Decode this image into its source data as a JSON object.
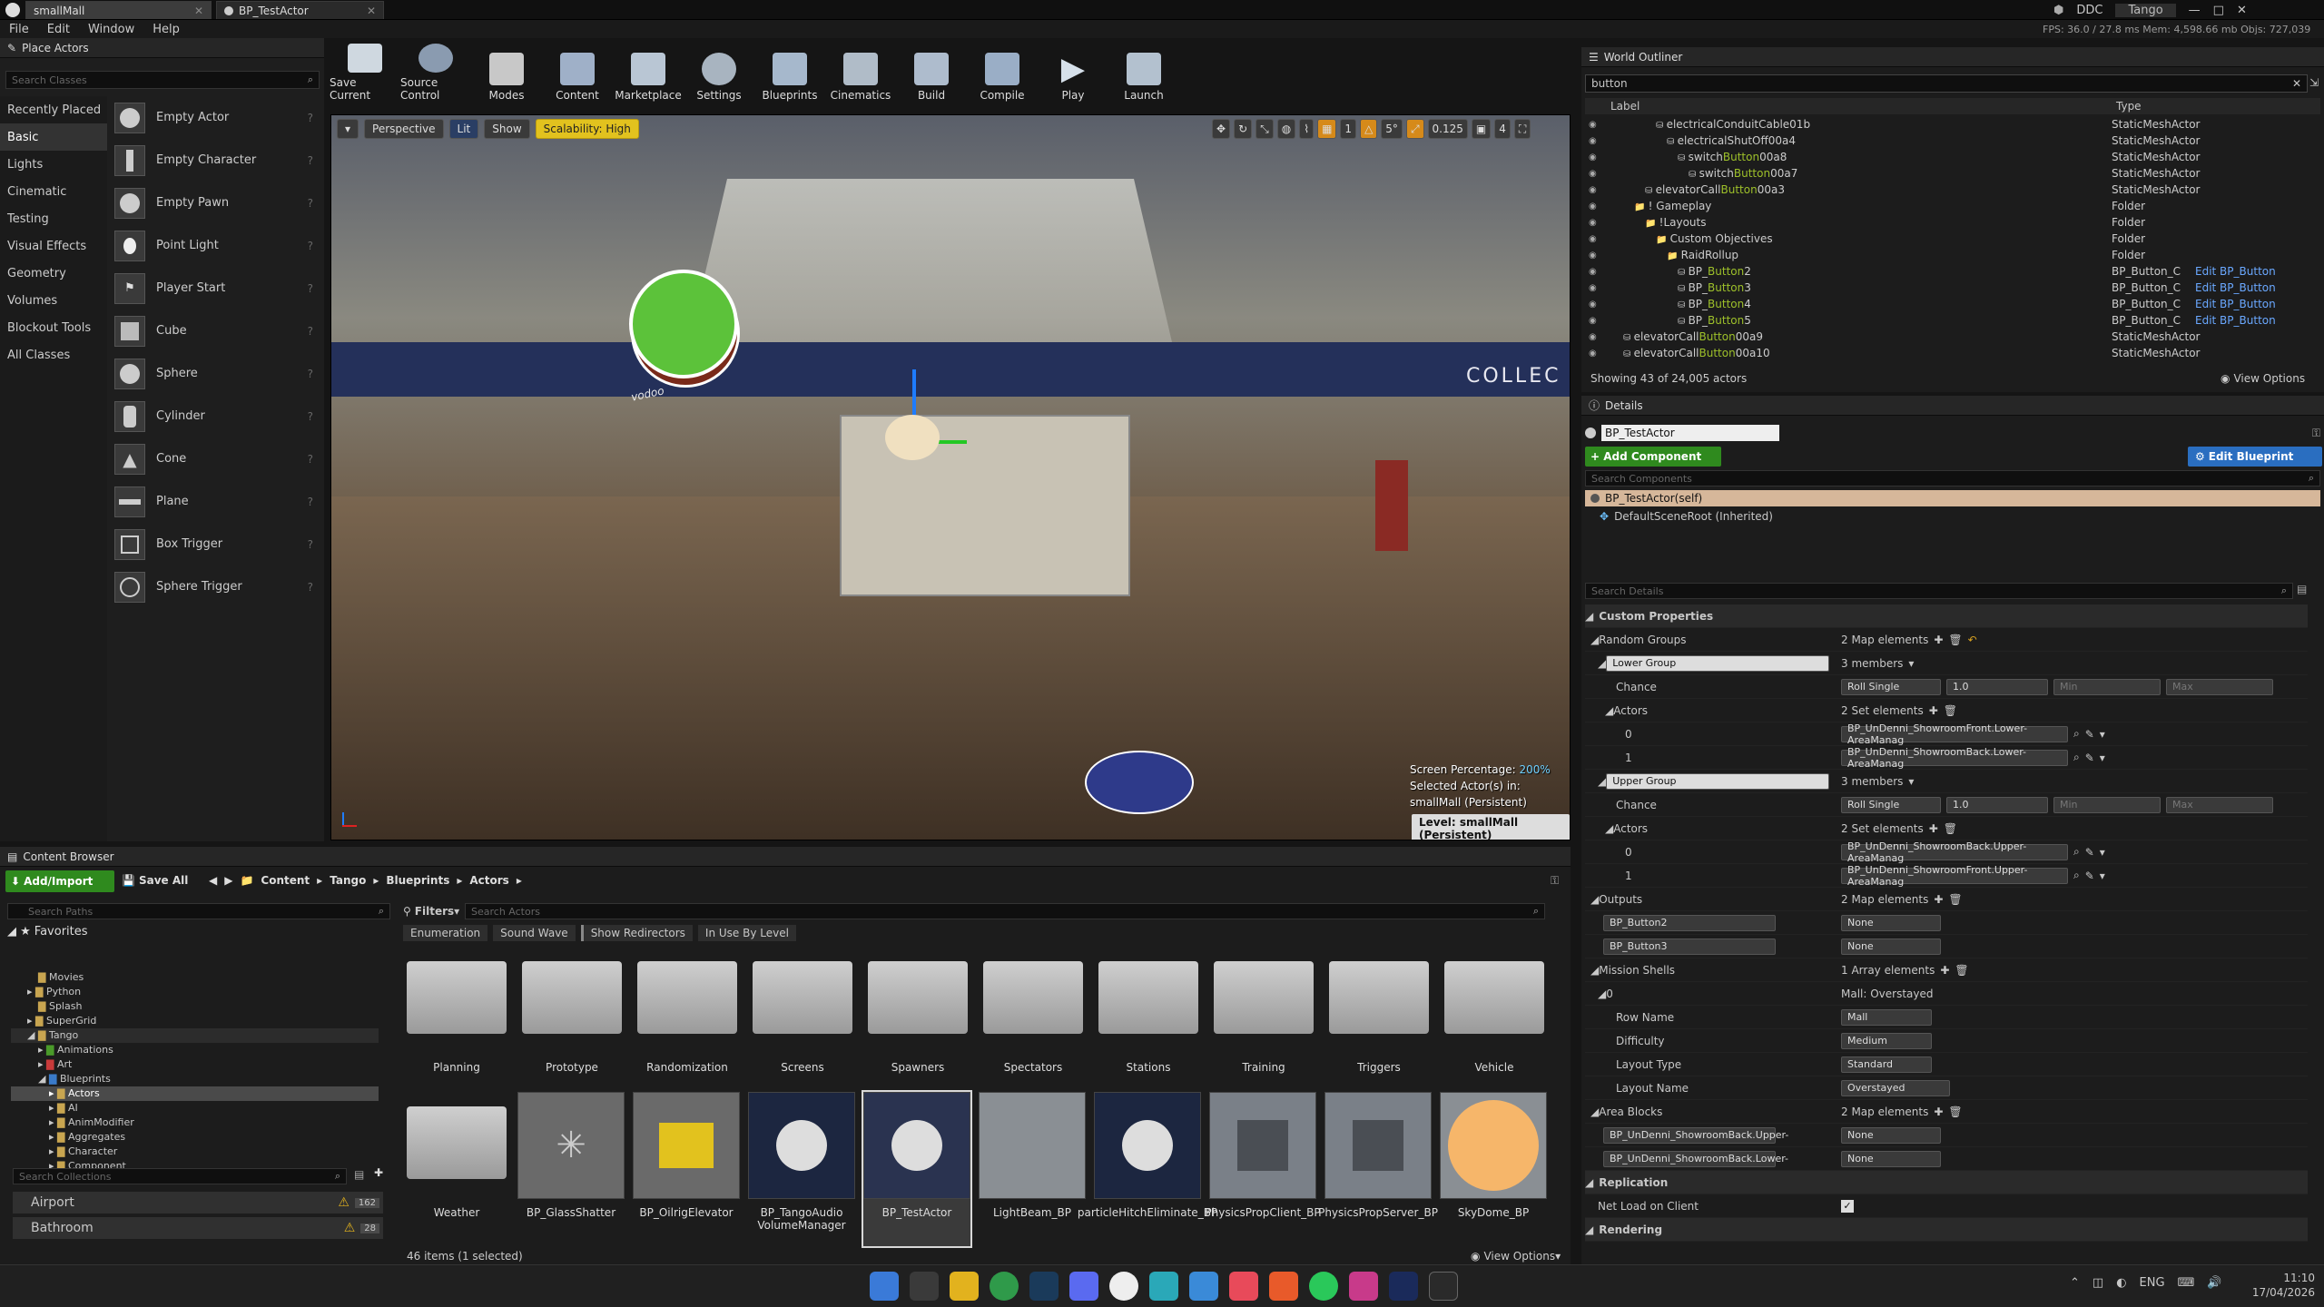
{
  "window": {
    "tab1": "smallMall",
    "tab2": "BP_TestActor",
    "ddc": "DDC",
    "project": "Tango",
    "stats": "FPS: 36.0  /  27.8 ms  Mem: 4,598.66 mb  Objs: 727,039"
  },
  "menu": [
    "File",
    "Edit",
    "Window",
    "Help"
  ],
  "place": {
    "title": "Place Actors",
    "search_placeholder": "Search Classes",
    "categories": [
      "Recently Placed",
      "Basic",
      "Lights",
      "Cinematic",
      "Testing",
      "Visual Effects",
      "Geometry",
      "Volumes",
      "Blockout Tools",
      "All Classes"
    ],
    "items": [
      "Empty Actor",
      "Empty Character",
      "Empty Pawn",
      "Point Light",
      "Player Start",
      "Cube",
      "Sphere",
      "Cylinder",
      "Cone",
      "Plane",
      "Box Trigger",
      "Sphere Trigger"
    ]
  },
  "toolbar": [
    "Save Current",
    "Source Control",
    "Modes",
    "Content",
    "Marketplace",
    "Settings",
    "Blueprints",
    "Cinematics",
    "Build",
    "Compile",
    "Play",
    "Launch"
  ],
  "viewport": {
    "perspective": "Perspective",
    "lit": "Lit",
    "show": "Show",
    "scalability": "Scalability: High",
    "snap_angle": "5°",
    "snap_scale": "0.125",
    "cam_speed": "4",
    "screen_pct_label": "Screen Percentage:",
    "screen_pct": "200%",
    "selected": "Selected Actor(s) in:",
    "level_name": "smallMall (Persistent)",
    "level_badge": "Level:  smallMall (Persistent)",
    "sign": "COLLEC",
    "decal": "vodoo"
  },
  "outliner": {
    "title": "World Outliner",
    "search": "button",
    "col_label": "Label",
    "col_type": "Type",
    "rows": [
      {
        "pre": "electricalConduitCable01b",
        "hl": "",
        "post": "",
        "type": "StaticMeshActor",
        "link": "",
        "indent": 4
      },
      {
        "pre": "electricalShutOff00a4",
        "hl": "",
        "post": "",
        "type": "StaticMeshActor",
        "link": "",
        "indent": 5
      },
      {
        "pre": "switch",
        "hl": "Button",
        "post": "00a8",
        "type": "StaticMeshActor",
        "link": "",
        "indent": 6
      },
      {
        "pre": "switch",
        "hl": "Button",
        "post": "00a7",
        "type": "StaticMeshActor",
        "link": "",
        "indent": 7
      },
      {
        "pre": "elevatorCall",
        "hl": "Button",
        "post": "00a3",
        "type": "StaticMeshActor",
        "link": "",
        "indent": 3
      },
      {
        "pre": "! Gameplay",
        "hl": "",
        "post": "",
        "type": "Folder",
        "link": "",
        "indent": 2
      },
      {
        "pre": "!Layouts",
        "hl": "",
        "post": "",
        "type": "Folder",
        "link": "",
        "indent": 3
      },
      {
        "pre": "Custom Objectives",
        "hl": "",
        "post": "",
        "type": "Folder",
        "link": "",
        "indent": 4
      },
      {
        "pre": "RaidRollup",
        "hl": "",
        "post": "",
        "type": "Folder",
        "link": "",
        "indent": 5
      },
      {
        "pre": "BP_",
        "hl": "Button",
        "post": "2",
        "type": "BP_Button_C",
        "link": "Edit BP_Button",
        "indent": 6
      },
      {
        "pre": "BP_",
        "hl": "Button",
        "post": "3",
        "type": "BP_Button_C",
        "link": "Edit BP_Button",
        "indent": 6
      },
      {
        "pre": "BP_",
        "hl": "Button",
        "post": "4",
        "type": "BP_Button_C",
        "link": "Edit BP_Button",
        "indent": 6
      },
      {
        "pre": "BP_",
        "hl": "Button",
        "post": "5",
        "type": "BP_Button_C",
        "link": "Edit BP_Button",
        "indent": 6
      },
      {
        "pre": "elevatorCall",
        "hl": "Button",
        "post": "00a9",
        "type": "StaticMeshActor",
        "link": "",
        "indent": 1
      },
      {
        "pre": "elevatorCall",
        "hl": "Button",
        "post": "00a10",
        "type": "StaticMeshActor",
        "link": "",
        "indent": 1
      }
    ],
    "footer": "Showing 43 of 24,005 actors",
    "view_options": "View Options"
  },
  "details": {
    "title": "Details",
    "actor_name": "BP_TestActor",
    "add_component": "+ Add Component",
    "edit_blueprint": "Edit Blueprint",
    "search_components": "Search Components",
    "self": "BP_TestActor(self)",
    "root": "DefaultSceneRoot (Inherited)",
    "search_details": "Search Details",
    "sections": {
      "custom": "Custom Properties",
      "replication": "Replication",
      "rendering": "Rendering"
    },
    "random_groups": "Random Groups",
    "map2": "2 Map elements",
    "lower_group": "Lower Group",
    "upper_group": "Upper Group",
    "members3": "3 members",
    "chance": "Chance",
    "roll_single": "Roll Single",
    "chance_val": "1.0",
    "min": "Min",
    "max": "Max",
    "one": "1",
    "actors": "Actors",
    "set2": "2 Set elements",
    "idx0": "0",
    "idx1": "1",
    "lower_a0": "BP_UnDenni_ShowroomFront.Lower-AreaManag",
    "lower_a1": "BP_UnDenni_ShowroomBack.Lower-AreaManag",
    "upper_a0": "BP_UnDenni_ShowroomBack.Upper-AreaManag",
    "upper_a1": "BP_UnDenni_ShowroomFront.Upper-AreaManag",
    "outputs": "Outputs",
    "out_k0": "BP_Button2",
    "out_k1": "BP_Button3",
    "none": "None",
    "mission_shells": "Mission Shells",
    "array1": "1 Array elements",
    "mall_overstayed": "Mall: Overstayed",
    "row_name": "Row Name",
    "row_name_val": "Mall",
    "difficulty": "Difficulty",
    "difficulty_val": "Medium",
    "layout_type": "Layout Type",
    "layout_type_val": "Standard",
    "layout_name": "Layout Name",
    "layout_name_val": "Overstayed",
    "area_blocks": "Area Blocks",
    "area_k0": "BP_UnDenni_ShowroomBack.Upper-",
    "area_k1": "BP_UnDenni_ShowroomBack.Lower-",
    "net_load": "Net Load on Client"
  },
  "content": {
    "title": "Content Browser",
    "add_import": "Add/Import",
    "save_all": "Save All",
    "path": [
      "Content",
      "Tango",
      "Blueprints",
      "Actors"
    ],
    "search_paths": "Search Paths",
    "favorites": "Favorites",
    "tree": [
      "Movies",
      "Python",
      "Splash",
      "SuperGrid",
      "Tango",
      "Animations",
      "Art",
      "Blueprints",
      "Actors",
      "AI",
      "AnimModifier",
      "Aggregates",
      "Character",
      "Component"
    ],
    "search_collections": "Search Collections",
    "collections": [
      {
        "name": "Airport",
        "count": "162"
      },
      {
        "name": "Bathroom",
        "count": "28"
      }
    ],
    "filters": "Filters",
    "search_actors": "Search Actors",
    "chips": [
      "Enumeration",
      "Sound Wave",
      "Show Redirectors",
      "In Use By Level"
    ],
    "folders": [
      "Planning",
      "Prototype",
      "Randomization",
      "Screens",
      "Spawners",
      "Spectators",
      "Stations",
      "Training",
      "Triggers",
      "Vehicle",
      "Weather"
    ],
    "assets": [
      "BP_GlassShatter",
      "BP_OilrigElevator",
      "BP_TangoAudio VolumeManager",
      "BP_TestActor",
      "LightBeam_BP",
      "particleHitchEliminate_BP",
      "PhysicsPropClient_BP",
      "PhysicsPropServer_BP",
      "SkyDome_BP"
    ],
    "count": "46 items (1 selected)",
    "view_options": "View Options"
  },
  "taskbar": {
    "lang": "ENG",
    "time": "11:10",
    "date": "17/04/2026"
  }
}
